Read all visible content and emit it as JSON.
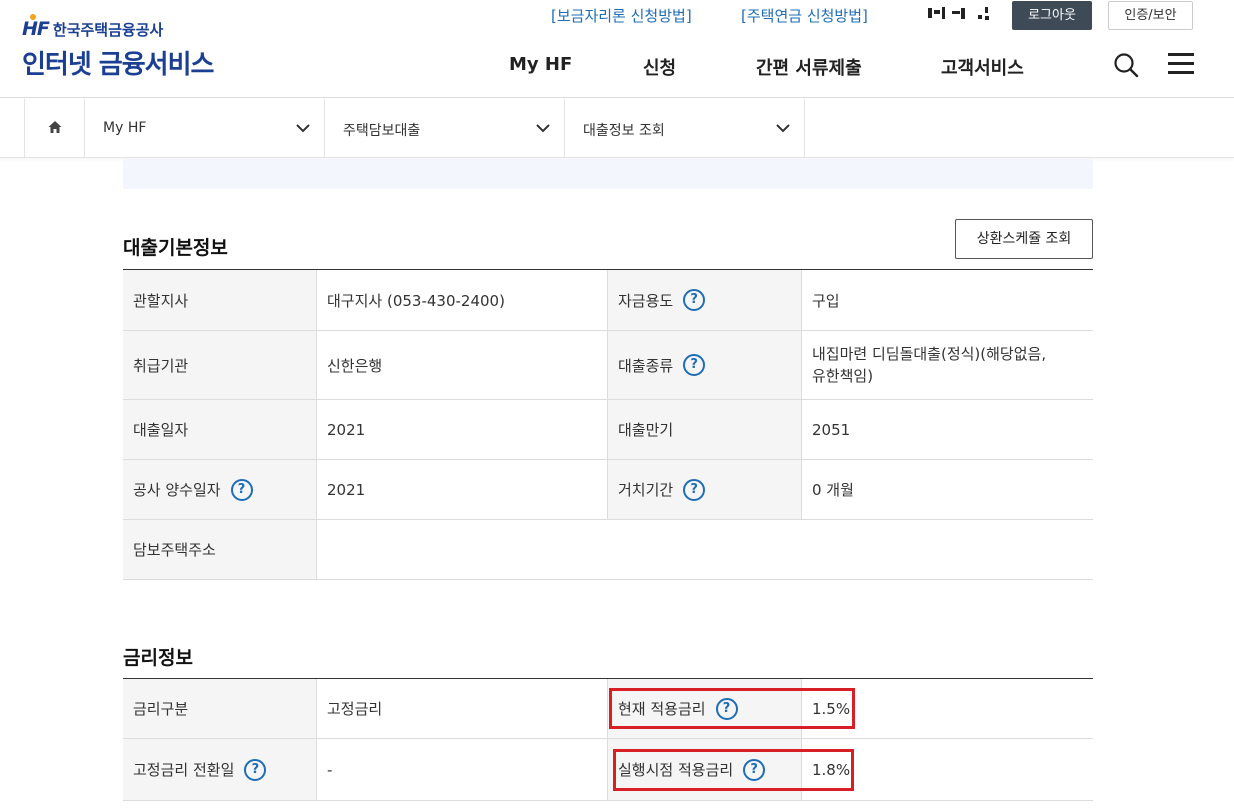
{
  "header": {
    "logo_hf": "HF",
    "logo_corp": "한국주택금융공사",
    "logo_main": "인터넷 금융서비스",
    "util_links": [
      "[보금자리론 신청방법]",
      "[주택연금 신청방법]"
    ],
    "logout_label": "로그아웃",
    "cert_label": "인증/보안",
    "gnb": [
      "My HF",
      "신청",
      "간편 서류제출",
      "고객서비스"
    ]
  },
  "breadcrumb": [
    "My HF",
    "주택담보대출",
    "대출정보 조회"
  ],
  "loan_basic": {
    "title": "대출기본정보",
    "schedule_button": "상환스케쥴 조회",
    "rows": [
      {
        "h1": "관할지사",
        "v1": "대구지사 (053-430-2400)",
        "h2": "자금용도",
        "v2": "구입"
      },
      {
        "h1": "취급기관",
        "v1": "신한은행",
        "h2": "대출종류",
        "v2a": "내집마련 디딤돌대출(정식)(해당없음,",
        "v2b": "유한책임)"
      },
      {
        "h1": "대출일자",
        "v1": "2021",
        "h2": "대출만기",
        "v2": "2051"
      },
      {
        "h1": "공사 양수일자",
        "v1": "2021",
        "h2": "거치기간",
        "v2": "0 개월"
      },
      {
        "h1": "담보주택주소",
        "v1": ""
      }
    ]
  },
  "rate_info": {
    "title": "금리정보",
    "rows": [
      {
        "h1": "금리구분",
        "v1": "고정금리",
        "h2": "현재 적용금리",
        "v2": "1.5%"
      },
      {
        "h1": "고정금리 전환일",
        "v1": "-",
        "h2": "실행시점 적용금리",
        "v2": "1.8%"
      }
    ]
  },
  "help_mark": "?",
  "colors": {
    "brand": "#1b3f93",
    "link": "#1f6db5",
    "highlight": "#d81f26"
  }
}
